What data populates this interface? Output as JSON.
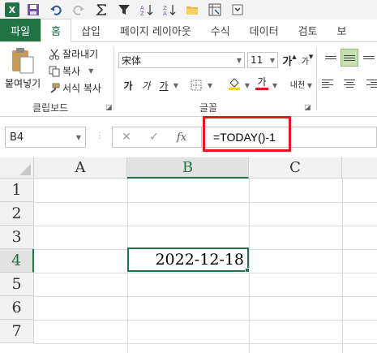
{
  "quick_access": {
    "app_icon": "excel-logo",
    "app_letter": "X",
    "icons": [
      "save-icon",
      "undo-icon",
      "redo-icon",
      "autosum-icon",
      "filter-icon",
      "sort-icon",
      "sort-reverse-icon",
      "open-folder-icon",
      "pivot-icon",
      "more-icon"
    ]
  },
  "tabs": [
    "파일",
    "홈",
    "삽입",
    "페이지 레이아웃",
    "수식",
    "데이터",
    "검토",
    "보"
  ],
  "active_tab": "홈",
  "ribbon": {
    "clipboard": {
      "paste_label": "붙여넣기",
      "cut_label": "잘라내기",
      "copy_label": "복사",
      "format_painter_label": "서식 복사",
      "group_label": "클립보드"
    },
    "font": {
      "font_name": "宋体",
      "font_size": "11",
      "grow_label": "가",
      "shrink_label": "가",
      "bold_label": "가",
      "italic_label": "가",
      "underline_label": "가",
      "font_color_label": "가",
      "phonetic_label": "내천",
      "group_label": "글꼴"
    }
  },
  "formula_bar": {
    "name_box": "B4",
    "cancel": "✕",
    "enter": "✓",
    "fx": "fx",
    "formula": "=TODAY()-1"
  },
  "sheet": {
    "columns": [
      "A",
      "B",
      "C"
    ],
    "selected_column": "B",
    "rows": [
      "1",
      "2",
      "3",
      "4",
      "5",
      "6",
      "7"
    ],
    "selected_row": "4",
    "active_cell": {
      "ref": "B4",
      "value": "2022-12-18"
    }
  },
  "colors": {
    "accent": "#217346",
    "highlight_box": "#e8171e"
  }
}
